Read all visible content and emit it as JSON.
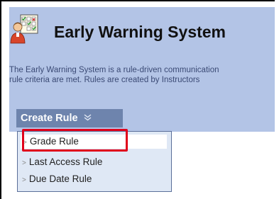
{
  "header": {
    "title": "Early Warning System",
    "description_line1": "The Early Warning System is a rule-driven communication",
    "description_line2": "rule criteria are met. Rules are created by Instructors"
  },
  "create_rule": {
    "label": "Create Rule",
    "chevron": "»"
  },
  "menu": {
    "items": [
      {
        "label": "Grade Rule"
      },
      {
        "label": "Last Access Rule"
      },
      {
        "label": "Due Date Rule"
      }
    ]
  },
  "colors": {
    "header_bg": "#b3c4e6",
    "button_bg": "#6e84ad",
    "menu_bg": "#dfe8f5",
    "highlight": "#e0001b"
  },
  "icons": {
    "logo": "teacher-with-checklist-icon",
    "menu_arrow": "chevron-right-icon"
  }
}
